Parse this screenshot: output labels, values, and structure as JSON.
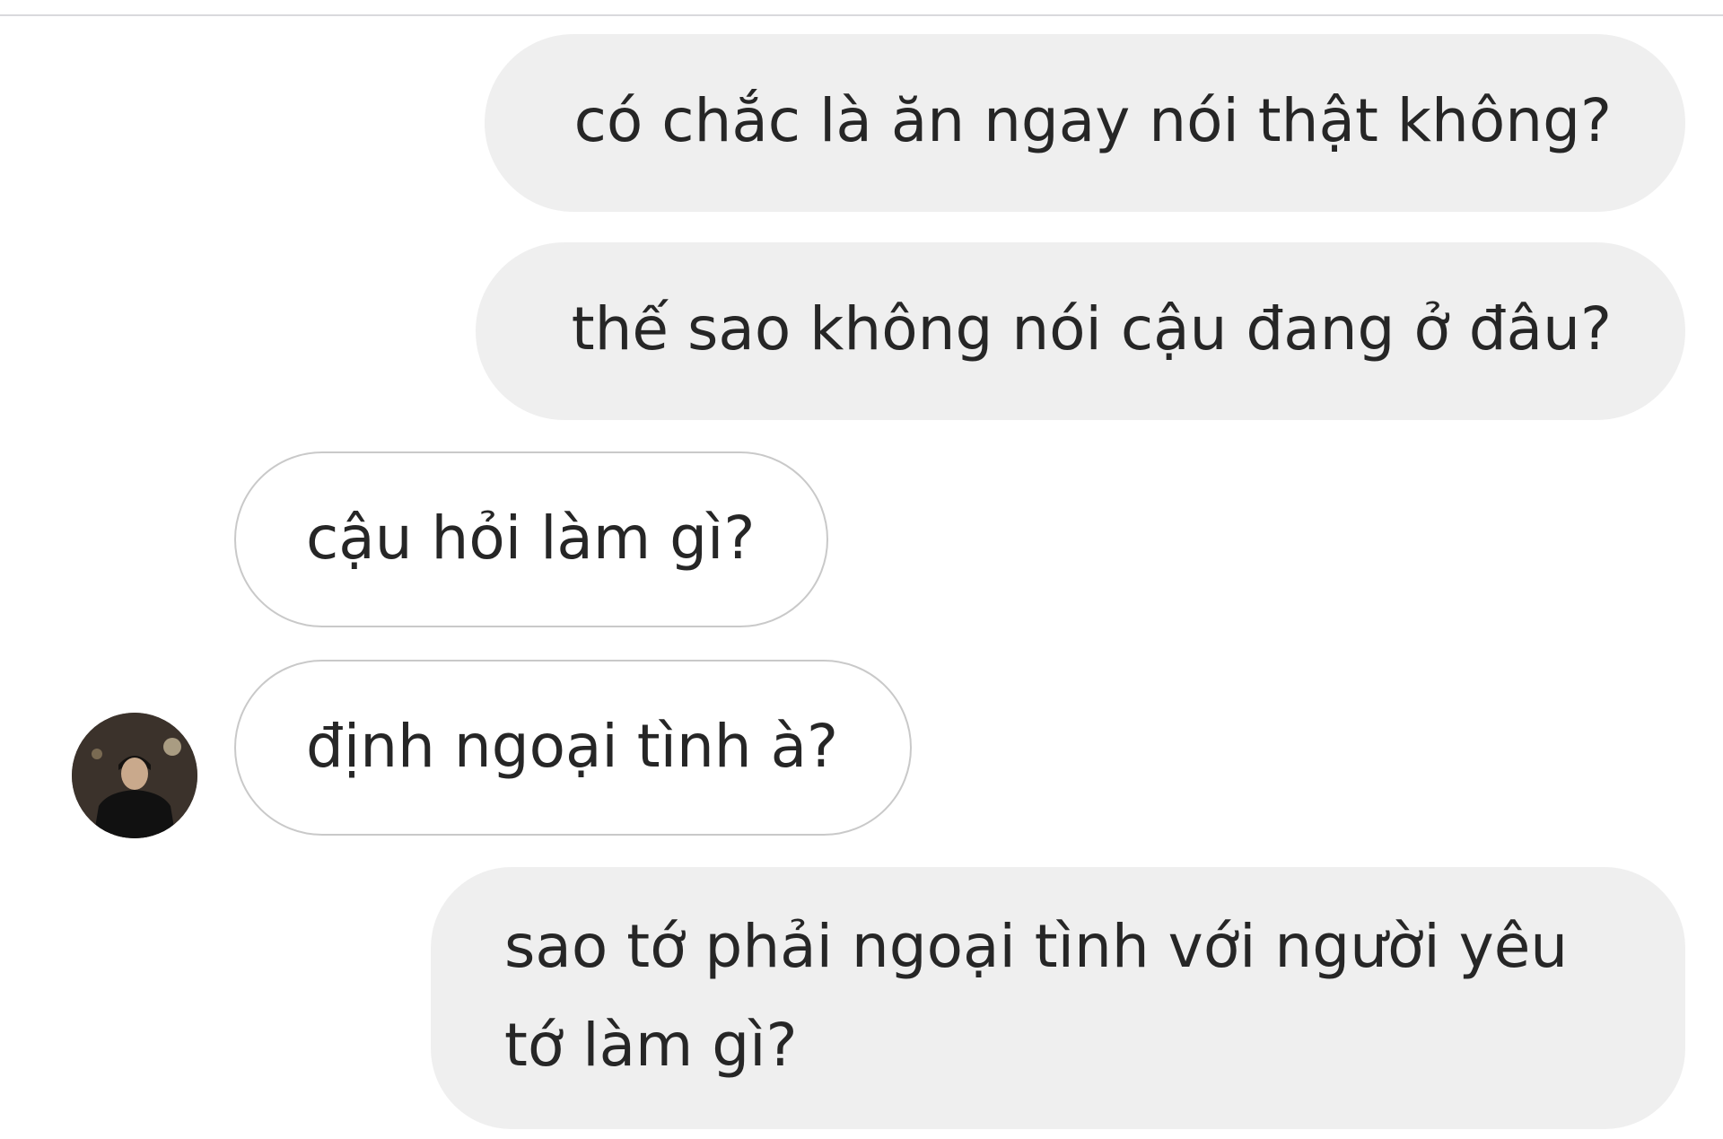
{
  "conversation": {
    "messages": [
      {
        "direction": "outgoing",
        "text": "có chắc là ăn ngay nói thật không?"
      },
      {
        "direction": "outgoing",
        "text": "thế sao không nói cậu đang ở đâu?"
      },
      {
        "direction": "incoming",
        "text": "cậu hỏi làm gì?"
      },
      {
        "direction": "incoming",
        "text": "định ngoại tình à?"
      },
      {
        "direction": "outgoing",
        "text": "sao tớ phải ngoại tình với người yêu tớ làm gì?"
      }
    ]
  },
  "contact": {
    "avatar_icon": "profile-photo-avatar"
  },
  "colors": {
    "outgoing_bubble": "#efefef",
    "incoming_bubble": "#ffffff",
    "incoming_border": "#c9c9c9",
    "text": "#262626"
  }
}
